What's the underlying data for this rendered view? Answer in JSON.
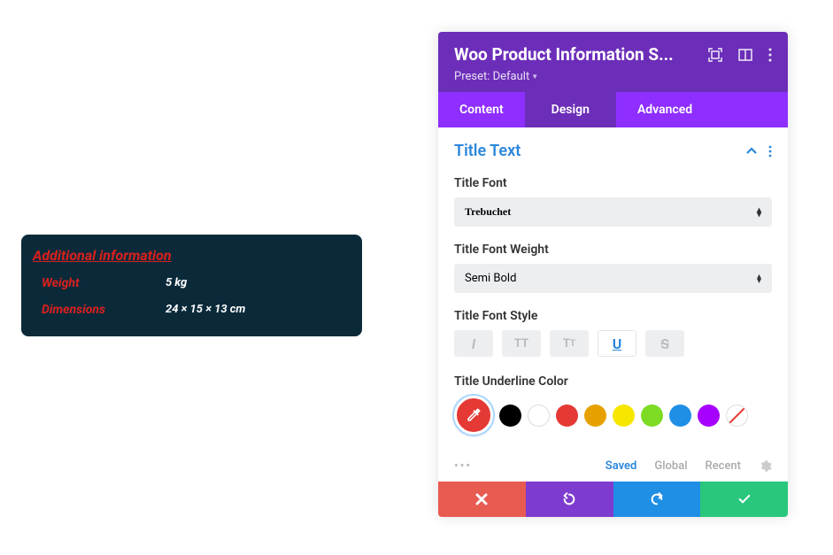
{
  "preview": {
    "title": "Additional information",
    "rows": [
      {
        "label": "Weight",
        "value": "5 kg"
      },
      {
        "label": "Dimensions",
        "value": "24 × 15 × 13 cm"
      }
    ]
  },
  "panel": {
    "title": "Woo Product Information S...",
    "preset": "Preset: Default",
    "tabs": [
      "Content",
      "Design",
      "Advanced"
    ],
    "active_tab": "Design",
    "section": "Title Text",
    "fields": {
      "font_label": "Title Font",
      "font_value": "Trebuchet",
      "weight_label": "Title Font Weight",
      "weight_value": "Semi Bold",
      "style_label": "Title Font Style",
      "underline_label": "Title Underline Color"
    },
    "footer_tabs": {
      "saved": "Saved",
      "global": "Global",
      "recent": "Recent"
    },
    "swatches": [
      {
        "name": "red-selected",
        "color": "#e53935",
        "selected": true
      },
      {
        "name": "black",
        "color": "#000000"
      },
      {
        "name": "white",
        "color": "#ffffff",
        "white": true
      },
      {
        "name": "red",
        "color": "#e53935"
      },
      {
        "name": "orange",
        "color": "#e6a100"
      },
      {
        "name": "yellow",
        "color": "#f7e600"
      },
      {
        "name": "green",
        "color": "#7cdb22"
      },
      {
        "name": "blue",
        "color": "#1f8fe6"
      },
      {
        "name": "purple",
        "color": "#a600ff"
      },
      {
        "name": "none",
        "color": "transparent",
        "none": true
      }
    ]
  }
}
